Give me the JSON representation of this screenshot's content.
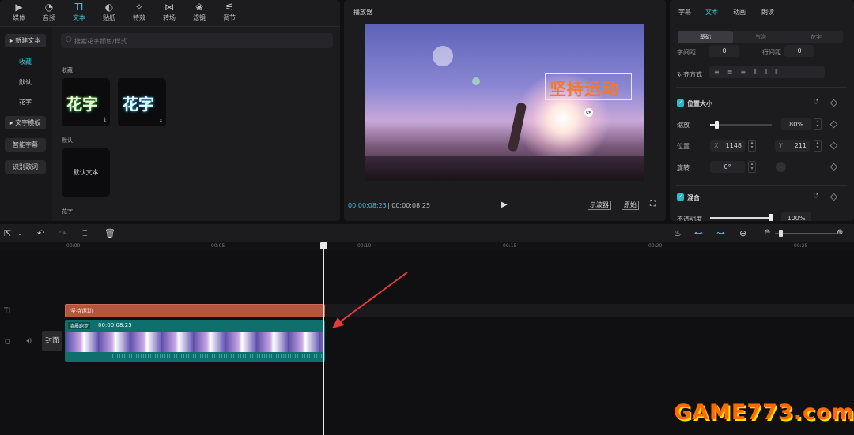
{
  "toolbar": {
    "tabs": [
      {
        "label": "媒体",
        "icon": "▶"
      },
      {
        "label": "音频",
        "icon": "◔"
      },
      {
        "label": "文本",
        "icon": "TI"
      },
      {
        "label": "贴纸",
        "icon": "◐"
      },
      {
        "label": "特效",
        "icon": "✧"
      },
      {
        "label": "转场",
        "icon": "⋈"
      },
      {
        "label": "滤镜",
        "icon": "❀"
      },
      {
        "label": "调节",
        "icon": "⚟"
      }
    ]
  },
  "left_nav": {
    "new_text": "新建文本",
    "favorites": "收藏",
    "default": "默认",
    "fancy": "花字",
    "template": "文字模板",
    "smart_caption": "智能字幕",
    "lyrics": "识别歌词"
  },
  "library": {
    "search_placeholder": "搜索花字颜色/样式",
    "section_favorites": "收藏",
    "fancy_sample": "花字",
    "section_default": "默认",
    "default_text": "默认文本",
    "section_fancy": "花字"
  },
  "player": {
    "title": "播放器",
    "overlay_text": "坚持运动",
    "time_current": "00:00:08:25",
    "time_total": "00:00:08:25",
    "btn_scope": "示波器",
    "btn_original": "原始"
  },
  "props": {
    "tabs": [
      "字幕",
      "文本",
      "动画",
      "朗读"
    ],
    "subtabs": [
      "基础",
      "气泡",
      "花字"
    ],
    "row_cut": "字间距",
    "row_cut2": "行间距",
    "align_label": "对齐方式",
    "pos_size": "位置大小",
    "scale_label": "缩放",
    "scale_value": "80%",
    "scale_level": 0.1,
    "position_label": "位置",
    "x_label": "X",
    "x_value": "1148",
    "y_label": "Y",
    "y_value": "211",
    "rotate_label": "旋转",
    "rotate_value": "0°",
    "blend": "混合",
    "opacity_label": "不透明度",
    "opacity_value": "100%",
    "opacity_level": 1.0
  },
  "timeline": {
    "ruler": [
      "00:00",
      "00:05",
      "00:10",
      "00:15",
      "00:20",
      "00:25"
    ],
    "text_track_icon": "TI",
    "text_clip": "坚持运动",
    "video_clip_name": "清晨跑步",
    "video_clip_dur": "00:00:08:25",
    "cover": "封面"
  },
  "watermark": "GAME773.com",
  "colors": {
    "accent": "#3ac5d6",
    "text_clip": "#b4553f",
    "video_clip": "#0f6f6c"
  }
}
